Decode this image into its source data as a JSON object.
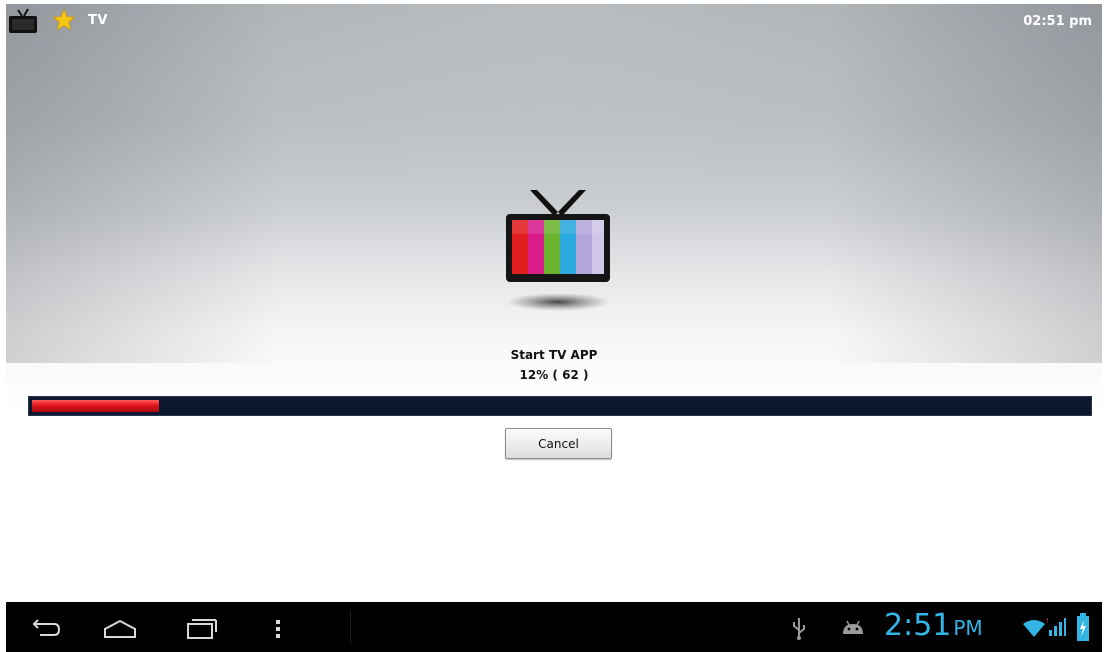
{
  "topbar": {
    "app_title": "TV",
    "app_icon": "tv-icon",
    "favorite_icon": "star-icon",
    "clock": "02:51 pm"
  },
  "loader": {
    "logo_icon": "tv-color-bars-icon",
    "title": "Start TV APP",
    "percent_text": "12% ( 62 )",
    "progress_fraction": 0.12,
    "cancel_label": "Cancel"
  },
  "navbar": {
    "buttons": [
      "back-icon",
      "home-icon",
      "recent-apps-icon",
      "menu-icon"
    ],
    "status_icons": [
      "usb-icon",
      "android-debug-icon",
      "wifi-icon",
      "signal-icon",
      "battery-charging-icon"
    ],
    "clock_time": "2:51",
    "clock_ampm": "PM"
  },
  "colors": {
    "progress_fill": "#e0141c",
    "progress_track": "#0d1830",
    "status_clock": "#33b5e5",
    "star": "#f6c616"
  }
}
